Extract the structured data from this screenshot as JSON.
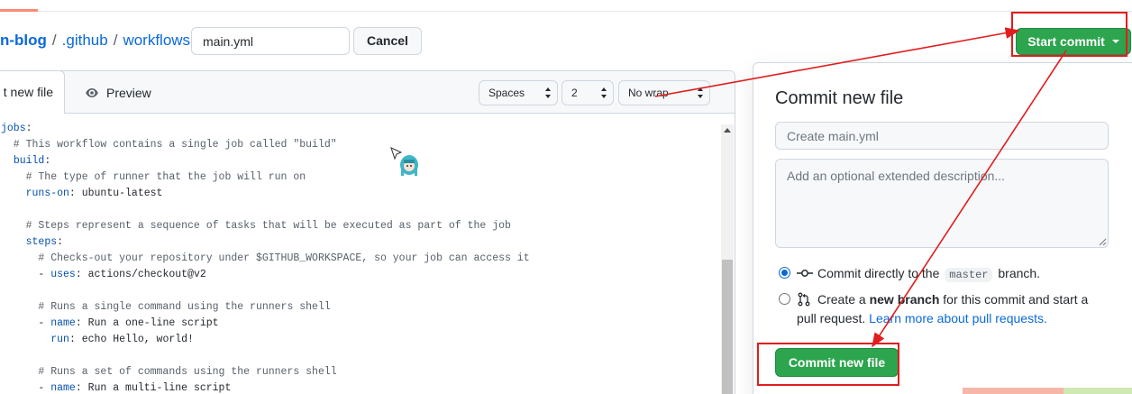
{
  "breadcrumb": {
    "repo": "n-blog",
    "sep": "/",
    "folder1": ".github",
    "folder2": "workflows"
  },
  "filename": {
    "value": "main.yml"
  },
  "cancel_label": "Cancel",
  "start_commit_label": "Start commit",
  "editor": {
    "tab_edit": "t new file",
    "tab_preview": "Preview",
    "indent_mode": "Spaces",
    "indent_size": "2",
    "wrap_mode": "No wrap",
    "lines": [
      "jobs:",
      "  # This workflow contains a single job called \"build\"",
      "  build:",
      "    # The type of runner that the job will run on",
      "    runs-on: ubuntu-latest",
      "",
      "    # Steps represent a sequence of tasks that will be executed as part of the job",
      "    steps:",
      "      # Checks-out your repository under $GITHUB_WORKSPACE, so your job can access it",
      "      - uses: actions/checkout@v2",
      "",
      "      # Runs a single command using the runners shell",
      "      - name: Run a one-line script",
      "        run: echo Hello, world!",
      "",
      "      # Runs a set of commands using the runners shell",
      "      - name: Run a multi-line script"
    ]
  },
  "commit_panel": {
    "title": "Commit new file",
    "summary_placeholder": "Create main.yml",
    "description_placeholder": "Add an optional extended description...",
    "option_direct_prefix": "Commit directly to the",
    "branch": "master",
    "option_direct_suffix": "branch.",
    "option_new_a": "Create a",
    "option_new_bold": "new branch",
    "option_new_b": "for this commit and start a",
    "option_new_c": "pull request.",
    "learn_more": "Learn more about pull requests.",
    "commit_button": "Commit new file"
  },
  "colors": {
    "primary_green": "#2da44e",
    "link_blue": "#0969da",
    "annotation_red": "#e11d1d"
  },
  "icons": [
    "eye-icon",
    "commit-icon",
    "pull-request-icon",
    "chevron-down-icon",
    "select-arrows-icon"
  ]
}
